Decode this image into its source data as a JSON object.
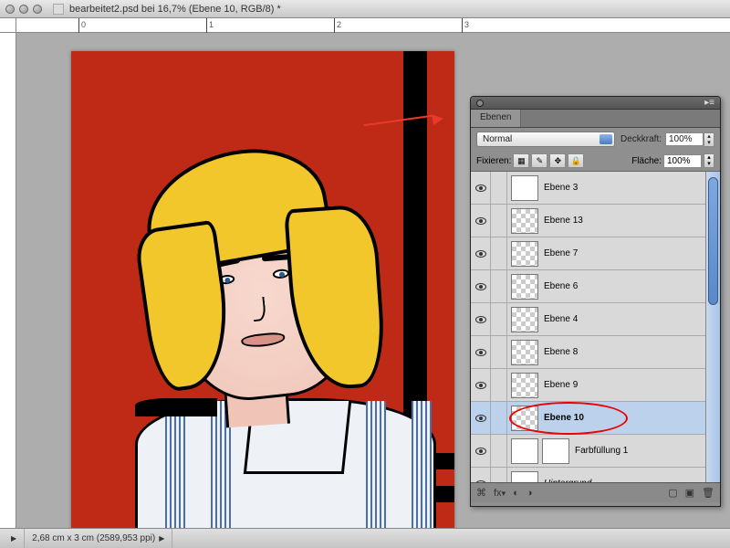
{
  "title": "bearbeitet2.psd bei 16,7% (Ebene 10, RGB/8) *",
  "ruler": {
    "ticks": [
      "0",
      "1",
      "2",
      "3"
    ]
  },
  "status": {
    "left_blank": "",
    "dims": "2,68 cm x 3 cm (2589,953 ppi)"
  },
  "panel": {
    "tab": "Ebenen",
    "blend_label": "Normal",
    "opacity_label": "Deckkraft:",
    "opacity_value": "100%",
    "lock_label": "Fixieren:",
    "fill_label": "Fläche:",
    "fill_value": "100%",
    "layers": [
      {
        "name": "Ebene 3",
        "selected": false,
        "checker": false,
        "italic": false,
        "mask": false
      },
      {
        "name": "Ebene 13",
        "selected": false,
        "checker": true,
        "italic": false,
        "mask": false
      },
      {
        "name": "Ebene 7",
        "selected": false,
        "checker": true,
        "italic": false,
        "mask": false
      },
      {
        "name": "Ebene 6",
        "selected": false,
        "checker": true,
        "italic": false,
        "mask": false
      },
      {
        "name": "Ebene 4",
        "selected": false,
        "checker": true,
        "italic": false,
        "mask": false
      },
      {
        "name": "Ebene 8",
        "selected": false,
        "checker": true,
        "italic": false,
        "mask": false
      },
      {
        "name": "Ebene 9",
        "selected": false,
        "checker": true,
        "italic": false,
        "mask": false
      },
      {
        "name": "Ebene 10",
        "selected": true,
        "checker": true,
        "italic": false,
        "mask": false
      },
      {
        "name": "Farbfüllung 1",
        "selected": false,
        "checker": false,
        "italic": false,
        "mask": true
      },
      {
        "name": "Hintergrund",
        "selected": false,
        "checker": false,
        "italic": true,
        "mask": false
      }
    ],
    "footer_icons": [
      "link",
      "fx",
      "mask",
      "adjust",
      "group",
      "new",
      "trash"
    ]
  }
}
